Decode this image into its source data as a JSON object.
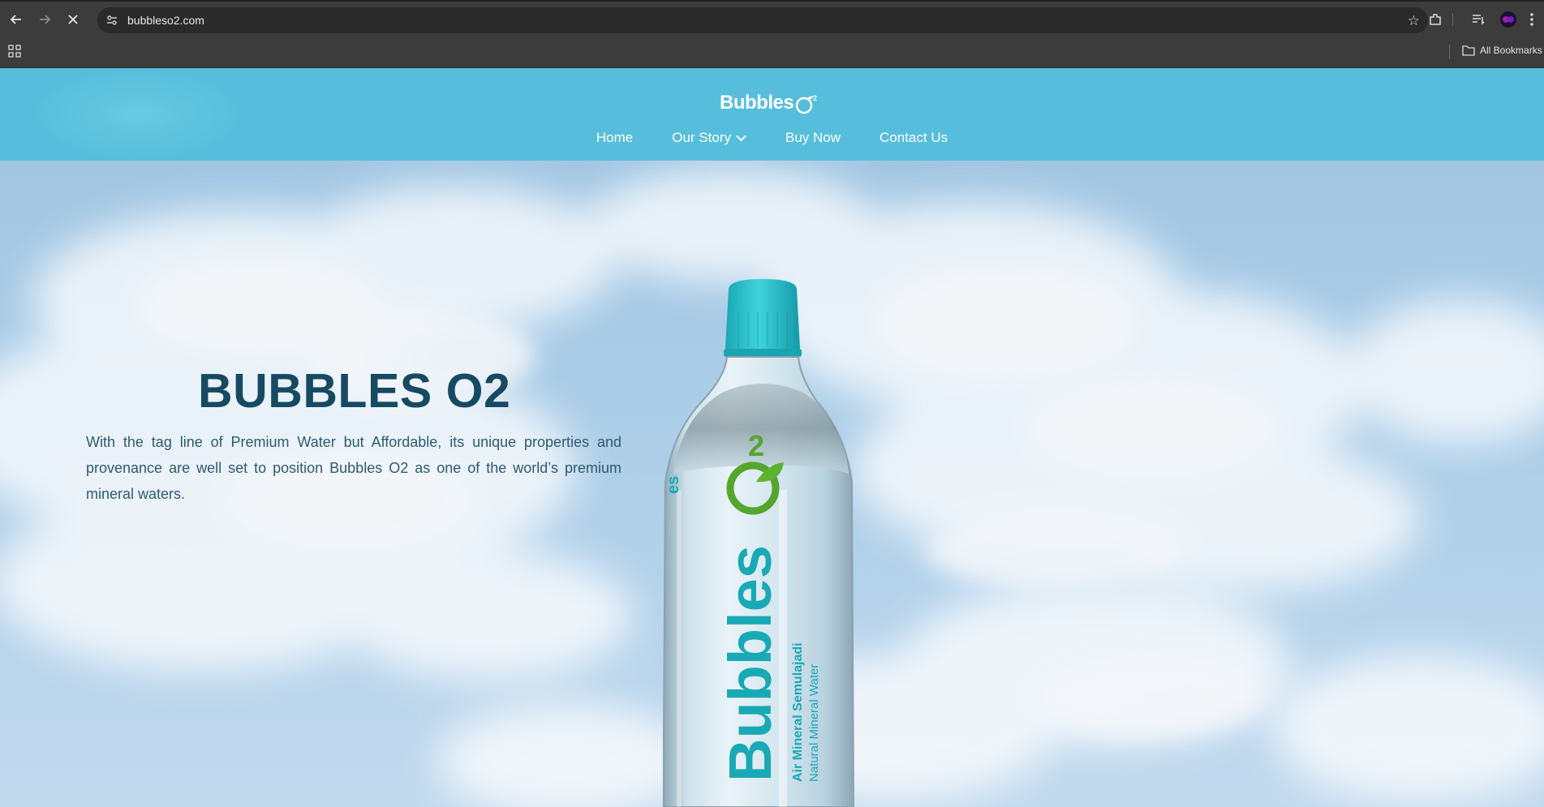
{
  "browser": {
    "url": "bubbleso2.com",
    "bookmarks_label": "All Bookmarks",
    "icons": [
      "back-arrow-icon",
      "forward-arrow-icon",
      "stop-loading-icon",
      "site-info-icon",
      "star-icon",
      "extensions-icon",
      "reading-list-icon",
      "profile-avatar-icon",
      "more-menu-icon",
      "apps-grid-icon",
      "folder-icon"
    ]
  },
  "site": {
    "brand": "Bubbles",
    "brand_superscript": "2",
    "nav": [
      {
        "label": "Home"
      },
      {
        "label": "Our Story",
        "has_dropdown": true
      },
      {
        "label": "Buy Now"
      },
      {
        "label": "Contact Us"
      }
    ],
    "colors": {
      "header": "#56bedc",
      "title": "#164a62",
      "text": "#2d5a70"
    }
  },
  "hero": {
    "title": "BUBBLES O2",
    "description": "With the tag line of Premium Water but Affordable, its unique properties and provenance are well set to position Bubbles O2 as one of the world’s premium mineral waters.",
    "bottle_label": {
      "brand": "Bubbles",
      "superscript": "2",
      "line1": "Air Mineral Semulajadi",
      "line2": "Natural Mineral Water",
      "side_brand": "es"
    }
  }
}
